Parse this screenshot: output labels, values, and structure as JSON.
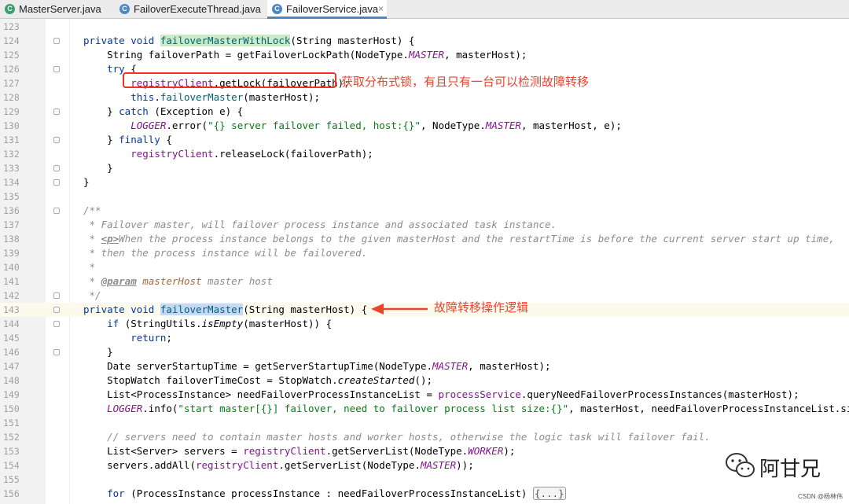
{
  "tabs": [
    {
      "label": "MasterServer.java",
      "active": false,
      "icon": "java-class-icon"
    },
    {
      "label": "FailoverExecuteThread.java",
      "active": false,
      "icon": "java-class-icon"
    },
    {
      "label": "FailoverService.java",
      "active": true,
      "icon": "java-class-icon"
    }
  ],
  "tab_close": "×",
  "annotations": {
    "lock_note": "获取分布式锁，有且只有一台可以检测故障转移",
    "failover_note": "故障转移操作逻辑"
  },
  "watermark": {
    "name": "阿甘兄",
    "credit": "CSDN @杨林伟"
  },
  "colors": {
    "keyword": "#0033b3",
    "string": "#067d17",
    "comment": "#8c8c8c",
    "field": "#871094",
    "annotation_red": "#e8442f"
  },
  "lines": [
    {
      "n": "123",
      "s": [
        {
          "t": ""
        }
      ]
    },
    {
      "n": "124",
      "fold": true,
      "s": [
        {
          "t": "private void ",
          "c": "kw"
        },
        {
          "t": "failoverMasterWithLock",
          "c": "fn hlgreen"
        },
        {
          "t": "(String masterHost) {"
        }
      ]
    },
    {
      "n": "125",
      "s": [
        {
          "t": "    String failoverPath = getFailoverLockPath(NodeType."
        },
        {
          "t": "MASTER",
          "c": "fld ital"
        },
        {
          "t": ", masterHost);"
        }
      ]
    },
    {
      "n": "126",
      "fold": true,
      "s": [
        {
          "t": "    "
        },
        {
          "t": "try",
          "c": "kw"
        },
        {
          "t": " {"
        }
      ]
    },
    {
      "n": "127",
      "s": [
        {
          "t": "        "
        },
        {
          "t": "registryClient",
          "c": "fld"
        },
        {
          "t": ".getLock(failoverPath);"
        }
      ]
    },
    {
      "n": "128",
      "s": [
        {
          "t": "        "
        },
        {
          "t": "this",
          "c": "kw"
        },
        {
          "t": "."
        },
        {
          "t": "failoverMaster",
          "c": "fn"
        },
        {
          "t": "(masterHost);"
        }
      ]
    },
    {
      "n": "129",
      "fold": true,
      "s": [
        {
          "t": "    } "
        },
        {
          "t": "catch",
          "c": "kw"
        },
        {
          "t": " (Exception e) {"
        }
      ]
    },
    {
      "n": "130",
      "s": [
        {
          "t": "        "
        },
        {
          "t": "LOGGER",
          "c": "fld ital"
        },
        {
          "t": ".error("
        },
        {
          "t": "\"{} server failover failed, host:{}\"",
          "c": "str"
        },
        {
          "t": ", NodeType."
        },
        {
          "t": "MASTER",
          "c": "fld ital"
        },
        {
          "t": ", masterHost, e);"
        }
      ]
    },
    {
      "n": "131",
      "fold": true,
      "s": [
        {
          "t": "    } "
        },
        {
          "t": "finally",
          "c": "kw"
        },
        {
          "t": " {"
        }
      ]
    },
    {
      "n": "132",
      "s": [
        {
          "t": "        "
        },
        {
          "t": "registryClient",
          "c": "fld"
        },
        {
          "t": ".releaseLock(failoverPath);"
        }
      ]
    },
    {
      "n": "133",
      "fold": true,
      "s": [
        {
          "t": "    }"
        }
      ]
    },
    {
      "n": "134",
      "fold": true,
      "s": [
        {
          "t": "}"
        }
      ]
    },
    {
      "n": "135",
      "s": [
        {
          "t": ""
        }
      ]
    },
    {
      "n": "136",
      "fold": true,
      "s": [
        {
          "t": "/**",
          "c": "doc"
        }
      ]
    },
    {
      "n": "137",
      "s": [
        {
          "t": " * Failover master, will failover process instance and associated task instance.",
          "c": "doc"
        }
      ]
    },
    {
      "n": "138",
      "s": [
        {
          "t": " * ",
          "c": "doc"
        },
        {
          "t": "<p>",
          "c": "doctag"
        },
        {
          "t": "When the process instance belongs to the given masterHost and the restartTime is before the current server start up time,",
          "c": "doc"
        }
      ]
    },
    {
      "n": "139",
      "s": [
        {
          "t": " * then the process instance will be ",
          "c": "doc"
        },
        {
          "t": "failovered",
          "c": "doc"
        },
        {
          "t": ".",
          "c": "doc"
        }
      ]
    },
    {
      "n": "140",
      "s": [
        {
          "t": " *",
          "c": "doc"
        }
      ]
    },
    {
      "n": "141",
      "s": [
        {
          "t": " * ",
          "c": "doc"
        },
        {
          "t": "@param",
          "c": "doctag"
        },
        {
          "t": " masterHost",
          "c": "docval"
        },
        {
          "t": " master host",
          "c": "doc"
        }
      ]
    },
    {
      "n": "142",
      "fold": true,
      "s": [
        {
          "t": " */",
          "c": "doc"
        }
      ]
    },
    {
      "n": "143",
      "fold": true,
      "cur": true,
      "s": [
        {
          "t": "private void ",
          "c": "kw"
        },
        {
          "t": "failoverMaster",
          "c": "fn hlblue"
        },
        {
          "t": "(String masterHost) {"
        }
      ]
    },
    {
      "n": "144",
      "fold": true,
      "s": [
        {
          "t": "    "
        },
        {
          "t": "if",
          "c": "kw"
        },
        {
          "t": " (StringUtils."
        },
        {
          "t": "isEmpty",
          "c": "ital"
        },
        {
          "t": "(masterHost)) {"
        }
      ]
    },
    {
      "n": "145",
      "s": [
        {
          "t": "        "
        },
        {
          "t": "return",
          "c": "kw"
        },
        {
          "t": ";"
        }
      ]
    },
    {
      "n": "146",
      "fold": true,
      "s": [
        {
          "t": "    }"
        }
      ]
    },
    {
      "n": "147",
      "s": [
        {
          "t": "    Date serverStartupTime = getServerStartupTime(NodeType."
        },
        {
          "t": "MASTER",
          "c": "fld ital"
        },
        {
          "t": ", masterHost);"
        }
      ]
    },
    {
      "n": "148",
      "s": [
        {
          "t": "    StopWatch failoverTimeCost = StopWatch."
        },
        {
          "t": "createStarted",
          "c": "ital"
        },
        {
          "t": "();"
        }
      ]
    },
    {
      "n": "149",
      "s": [
        {
          "t": "    List<ProcessInstance> needFailoverProcessInstanceList = "
        },
        {
          "t": "processService",
          "c": "fld"
        },
        {
          "t": ".queryNeedFailoverProcessInstances(masterHost);"
        }
      ]
    },
    {
      "n": "150",
      "s": [
        {
          "t": "    "
        },
        {
          "t": "LOGGER",
          "c": "fld ital"
        },
        {
          "t": ".info("
        },
        {
          "t": "\"start master[{}] failover, need to failover process list size:{}\"",
          "c": "str"
        },
        {
          "t": ", masterHost, needFailoverProcessInstanceList.size());"
        }
      ]
    },
    {
      "n": "151",
      "s": [
        {
          "t": ""
        }
      ]
    },
    {
      "n": "152",
      "s": [
        {
          "t": "    // servers need to contain master hosts and worker hosts, otherwise the logic task will failover fail.",
          "c": "cm"
        }
      ]
    },
    {
      "n": "153",
      "s": [
        {
          "t": "    List<Server> servers = "
        },
        {
          "t": "registryClient",
          "c": "fld"
        },
        {
          "t": ".getServerList(NodeType."
        },
        {
          "t": "WORKER",
          "c": "fld ital"
        },
        {
          "t": ");"
        }
      ]
    },
    {
      "n": "154",
      "s": [
        {
          "t": "    servers.addAll("
        },
        {
          "t": "registryClient",
          "c": "fld"
        },
        {
          "t": ".getServerList(NodeType."
        },
        {
          "t": "MASTER",
          "c": "fld ital"
        },
        {
          "t": "));"
        }
      ]
    },
    {
      "n": "155",
      "s": [
        {
          "t": ""
        }
      ]
    },
    {
      "n": "156",
      "s": [
        {
          "t": "    "
        },
        {
          "t": "for",
          "c": "kw"
        },
        {
          "t": " (ProcessInstance processInstance : needFailoverProcessInstanceList) "
        },
        {
          "t": "{...}",
          "c": "fold-box"
        }
      ]
    }
  ]
}
